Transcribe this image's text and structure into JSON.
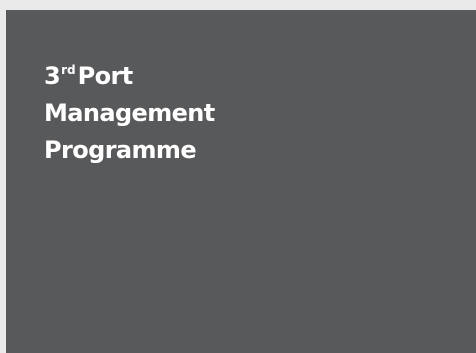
{
  "card": {
    "background_color": "#58595b",
    "text_color": "#ffffff",
    "title": {
      "line1_number": "3",
      "line1_ordinal": "rd",
      "line1_rest": "Port",
      "line2": "Management",
      "line3": "Programme"
    }
  },
  "page": {
    "background_color": "#eaeaeb"
  }
}
